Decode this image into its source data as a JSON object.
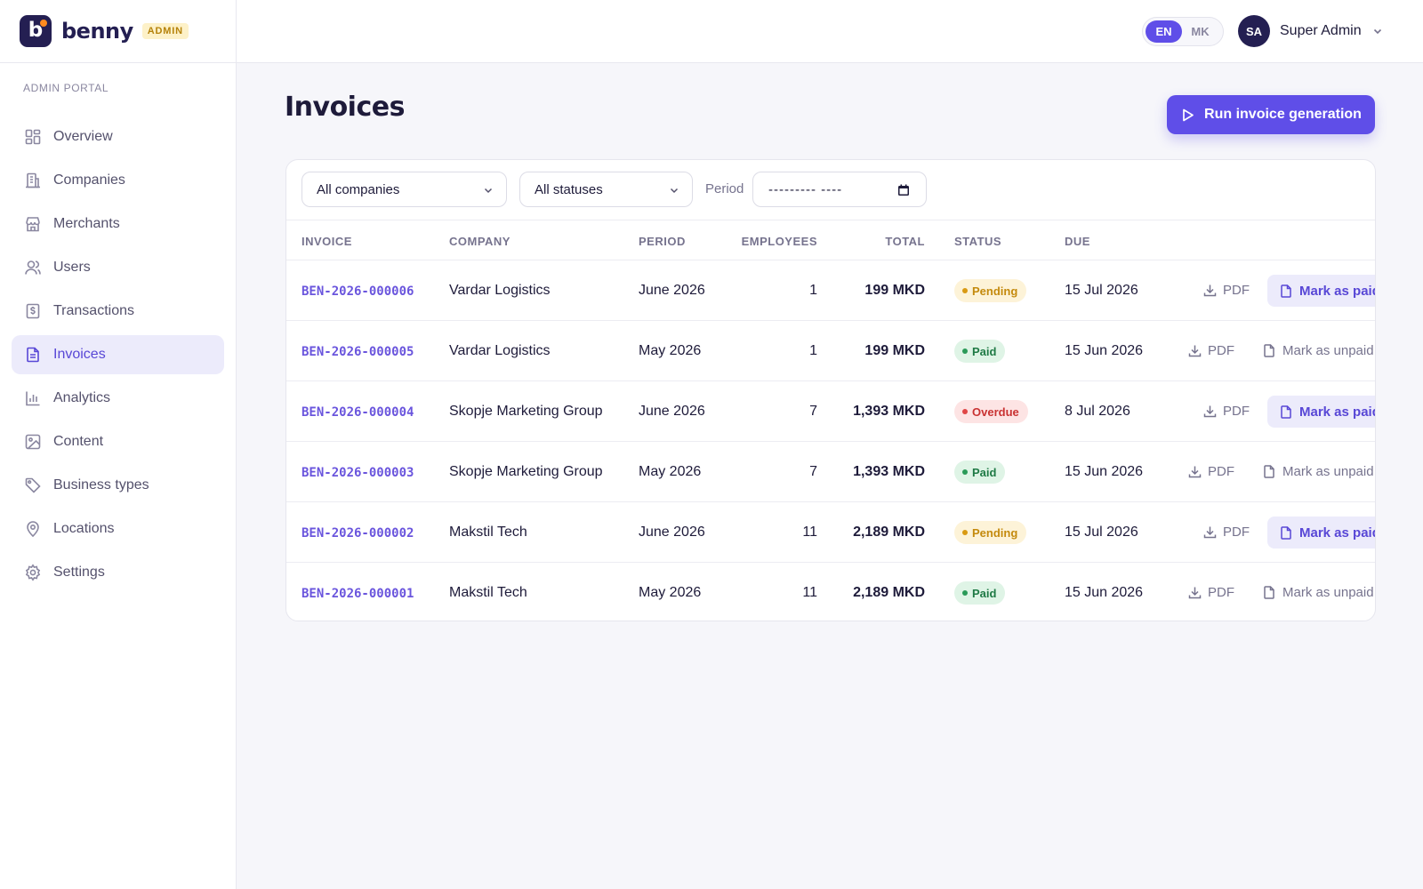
{
  "brand": {
    "letter": "b",
    "name": "benny",
    "badge": "ADMIN"
  },
  "sidebar": {
    "section_label": "ADMIN PORTAL",
    "items": [
      {
        "label": "Overview",
        "icon": "grid-icon"
      },
      {
        "label": "Companies",
        "icon": "building-icon"
      },
      {
        "label": "Merchants",
        "icon": "store-icon"
      },
      {
        "label": "Users",
        "icon": "users-icon"
      },
      {
        "label": "Transactions",
        "icon": "receipt-dollar-icon"
      },
      {
        "label": "Invoices",
        "icon": "document-icon",
        "active": true
      },
      {
        "label": "Analytics",
        "icon": "bar-chart-icon"
      },
      {
        "label": "Content",
        "icon": "image-icon"
      },
      {
        "label": "Business types",
        "icon": "tag-icon"
      },
      {
        "label": "Locations",
        "icon": "map-pin-icon"
      },
      {
        "label": "Settings",
        "icon": "gear-icon"
      }
    ]
  },
  "topbar": {
    "languages": [
      "EN",
      "MK"
    ],
    "active_language": "EN",
    "user_initials": "SA",
    "user_name": "Super Admin"
  },
  "main": {
    "title": "Invoices",
    "run_button": "Run invoice generation",
    "filters": {
      "company": "All companies",
      "status": "All statuses",
      "period_label": "Period",
      "period_value": "--------- ----"
    },
    "columns": [
      "INVOICE",
      "COMPANY",
      "PERIOD",
      "EMPLOYEES",
      "TOTAL",
      "STATUS",
      "DUE"
    ],
    "rows": [
      {
        "invoice": "BEN-2026-000006",
        "company": "Vardar Logistics",
        "period": "June 2026",
        "employees": "1",
        "total": "199 MKD",
        "status": "Pending",
        "due": "15 Jul 2026",
        "pdf": "PDF",
        "action": "Mark as paid"
      },
      {
        "invoice": "BEN-2026-000005",
        "company": "Vardar Logistics",
        "period": "May 2026",
        "employees": "1",
        "total": "199 MKD",
        "status": "Paid",
        "due": "15 Jun 2026",
        "pdf": "PDF",
        "action": "Mark as unpaid"
      },
      {
        "invoice": "BEN-2026-000004",
        "company": "Skopje Marketing Group",
        "period": "June 2026",
        "employees": "7",
        "total": "1,393 MKD",
        "status": "Overdue",
        "due": "8 Jul 2026",
        "pdf": "PDF",
        "action": "Mark as paid"
      },
      {
        "invoice": "BEN-2026-000003",
        "company": "Skopje Marketing Group",
        "period": "May 2026",
        "employees": "7",
        "total": "1,393 MKD",
        "status": "Paid",
        "due": "15 Jun 2026",
        "pdf": "PDF",
        "action": "Mark as unpaid"
      },
      {
        "invoice": "BEN-2026-000002",
        "company": "Makstil Tech",
        "period": "June 2026",
        "employees": "11",
        "total": "2,189 MKD",
        "status": "Pending",
        "due": "15 Jul 2026",
        "pdf": "PDF",
        "action": "Mark as paid"
      },
      {
        "invoice": "BEN-2026-000001",
        "company": "Makstil Tech",
        "period": "May 2026",
        "employees": "11",
        "total": "2,189 MKD",
        "status": "Paid",
        "due": "15 Jun 2026",
        "pdf": "PDF",
        "action": "Mark as unpaid"
      }
    ]
  },
  "colors": {
    "accent": "#5f4ee8",
    "brand_dark": "#241f52",
    "pending": "#c48a0d",
    "paid": "#1f7a45",
    "overdue": "#c93232"
  }
}
